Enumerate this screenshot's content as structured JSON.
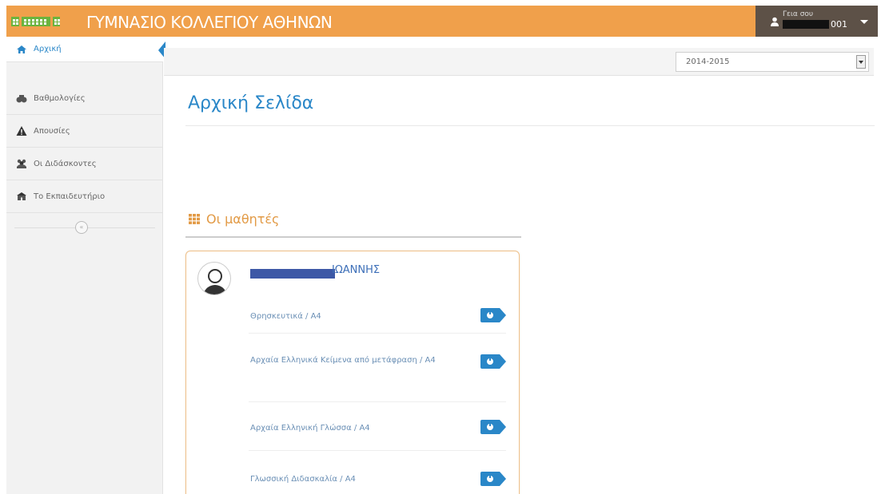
{
  "header": {
    "title": "ΓΥΜΝΑΣΙΟ ΚΟΛΛΕΓΙΟΥ ΑΘΗΝΩΝ",
    "user_greeting": "Γεια σου",
    "user_name_suffix": "001",
    "colors": {
      "bar": "#f0a04b",
      "user_menu": "#5d5147",
      "logo_green": "#6bb33d"
    }
  },
  "sidebar": {
    "items": [
      {
        "label": "Αρχική",
        "icon": "home-icon",
        "active": true
      },
      {
        "label": "Βαθμολογίες",
        "icon": "chart-icon"
      },
      {
        "label": "Απουσίες",
        "icon": "warning-icon"
      },
      {
        "label": "Οι Διδάσκοντες",
        "icon": "users-icon"
      },
      {
        "label": "Το Εκπαιδευτήριο",
        "icon": "school-icon"
      }
    ],
    "collapse_icon": "collapse-icon"
  },
  "topbar": {
    "year": "2014-2015"
  },
  "main": {
    "page_title": "Αρχική Σελίδα",
    "section_title": "Οι μαθητές",
    "student": {
      "name": "ΙΩΑΝΝΗΣ",
      "courses": [
        {
          "label": "Θρησκευτικά / Α4"
        },
        {
          "label": "Αρχαία Ελληνικά Κείμενα από μετάφραση / Α4"
        },
        {
          "label": "Αρχαία Ελληνική Γλώσσα / Α4"
        },
        {
          "label": "Γλωσσική Διδασκαλία / Α4"
        }
      ]
    }
  },
  "accent": "#2a87c8"
}
